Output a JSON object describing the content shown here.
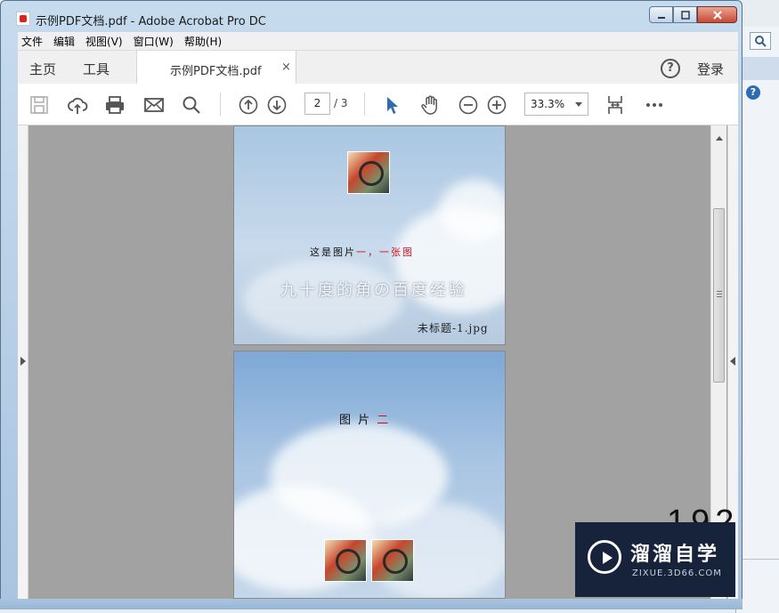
{
  "window": {
    "title": "示例PDF文档.pdf - Adobe Acrobat Pro DC"
  },
  "menubar": {
    "items": [
      "文件",
      "编辑",
      "视图(V)",
      "窗口(W)",
      "帮助(H)"
    ]
  },
  "tabbar": {
    "home": "主页",
    "tools": "工具",
    "doc_tab": "示例PDF文档.pdf",
    "close": "×",
    "help": "?",
    "login": "登录"
  },
  "toolbar": {
    "current_page": "2",
    "total_pages": "/ 3",
    "zoom": "33.3%",
    "icons": [
      "save-icon",
      "upload-cloud-icon",
      "print-icon",
      "email-icon",
      "search-icon",
      "previous-page-icon",
      "next-page-icon",
      "select-cursor-icon",
      "hand-tool-icon",
      "zoom-out-icon",
      "zoom-in-icon",
      "fit-page-icon",
      "more-icon"
    ]
  },
  "page1": {
    "caption_prefix": "这是图片",
    "caption_red": "一，一张图",
    "watermark": "九十度的角の百度经验",
    "filename": "未标题-1.jpg"
  },
  "page2": {
    "caption_prefix": "图 片",
    "caption_red": "二"
  },
  "overlay": {
    "number": "192",
    "brand_cn": "溜溜自学",
    "brand_en": "ZIXUE.3D66.COM"
  },
  "colors": {
    "accent_blue": "#2d6bb5",
    "caption_red": "#c8141b",
    "brand_bg": "#16233a"
  }
}
